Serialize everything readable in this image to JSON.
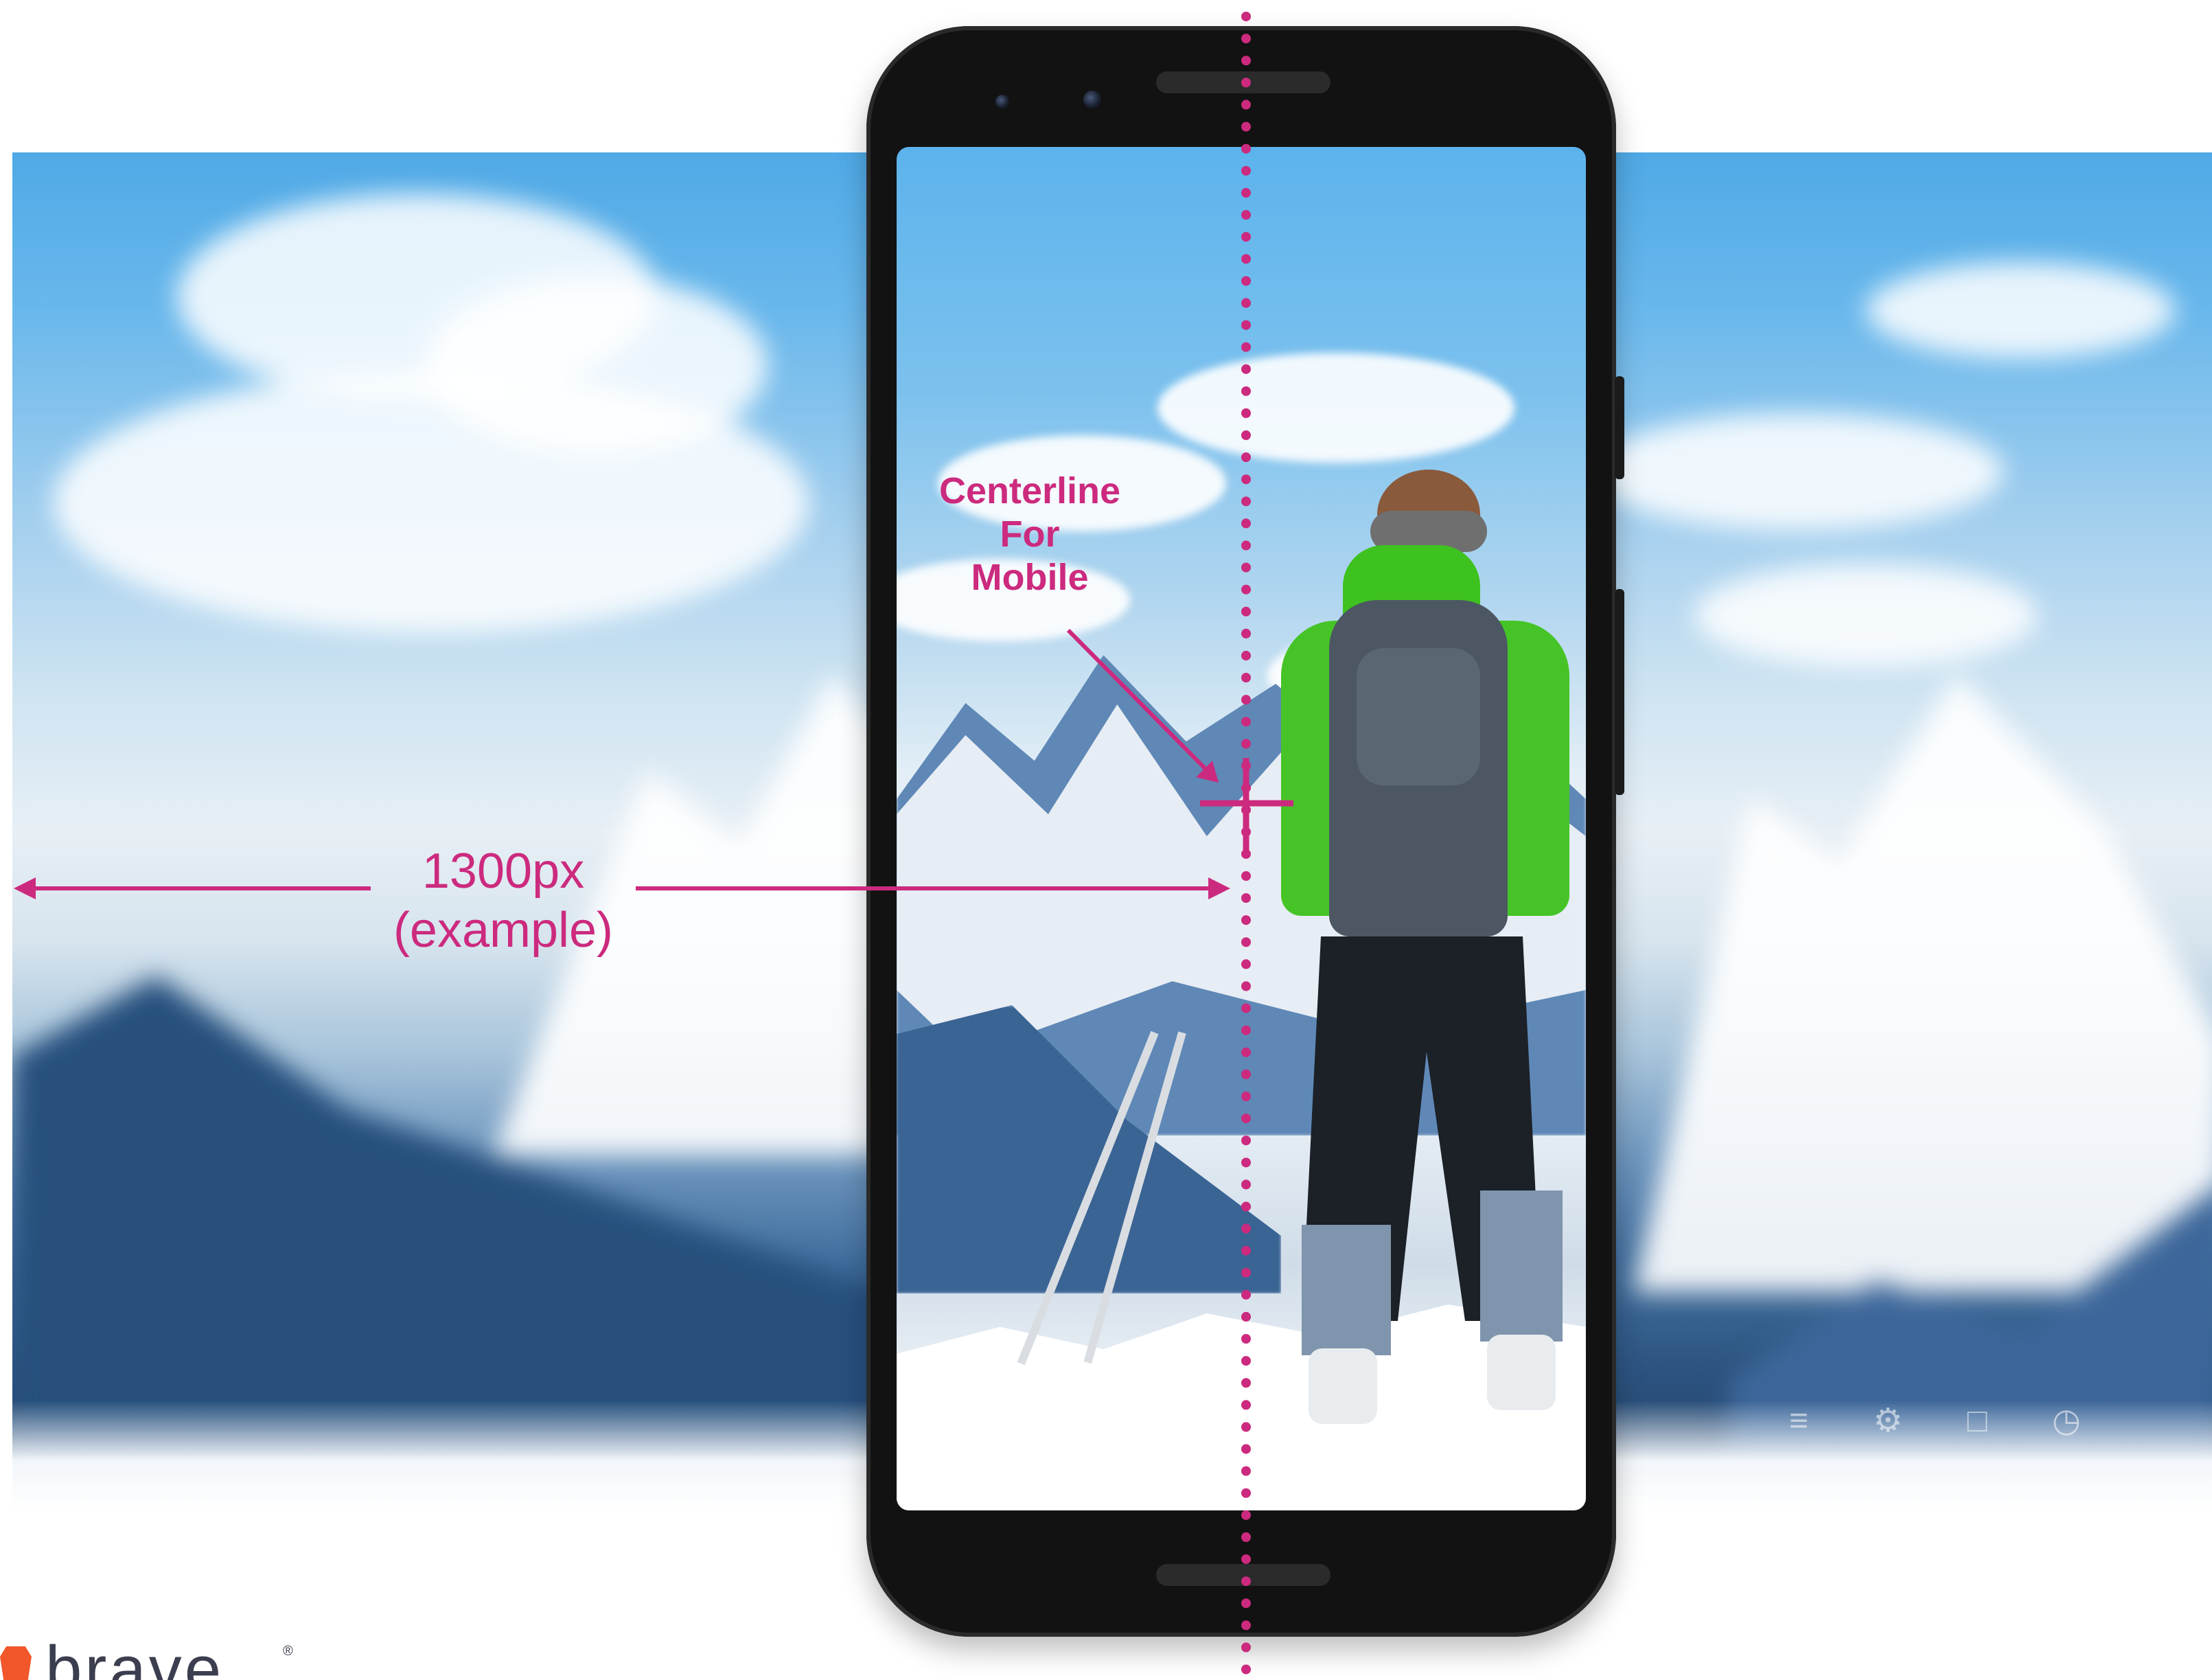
{
  "annotations": {
    "centerline_label_lines": [
      "Centerline",
      "For",
      "Mobile"
    ],
    "width_label_lines": [
      "1300px",
      "(example)"
    ]
  },
  "brand": {
    "wordmark": "brave",
    "registered": "®"
  },
  "colors": {
    "annotation": "#cc2a7e",
    "phone_body": "#121212",
    "brand_orange": "#f2572b",
    "brand_text": "#3b3e4f"
  },
  "icons": [
    "sliders-icon",
    "gear-icon",
    "bookmark-icon",
    "clock-icon"
  ]
}
